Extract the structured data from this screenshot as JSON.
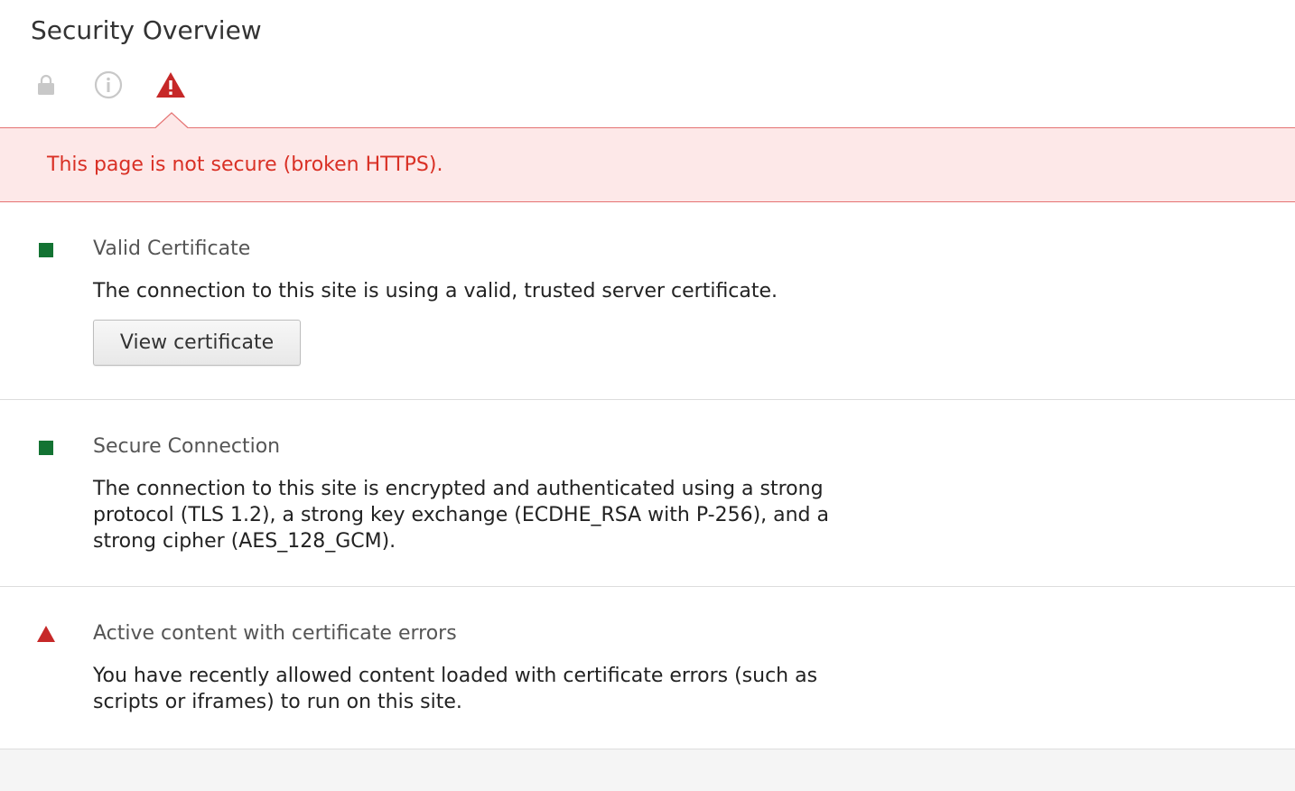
{
  "header": {
    "title": "Security Overview"
  },
  "summary_icons": [
    {
      "name": "lock-icon",
      "color": "#c8c8c8"
    },
    {
      "name": "info-icon",
      "color": "#c8c8c8"
    },
    {
      "name": "warning-icon",
      "color": "#c62828",
      "selected": true
    }
  ],
  "banner": {
    "text": "This page is not secure (broken HTTPS).",
    "text_color": "#d93025",
    "background": "#fde8e8"
  },
  "sections": [
    {
      "status": "secure",
      "status_color": "#137333",
      "title": "Valid Certificate",
      "description": "The connection to this site is using a valid, trusted server certificate.",
      "button_label": "View certificate"
    },
    {
      "status": "secure",
      "status_color": "#137333",
      "title": "Secure Connection",
      "description": "The connection to this site is encrypted and authenticated using a strong protocol (TLS 1.2), a strong key exchange (ECDHE_RSA with P-256), and a strong cipher (AES_128_GCM)."
    },
    {
      "status": "warning",
      "status_color": "#c62828",
      "title": "Active content with certificate errors",
      "description": "You have recently allowed content loaded with certificate errors (such as scripts or iframes) to run on this site."
    }
  ]
}
